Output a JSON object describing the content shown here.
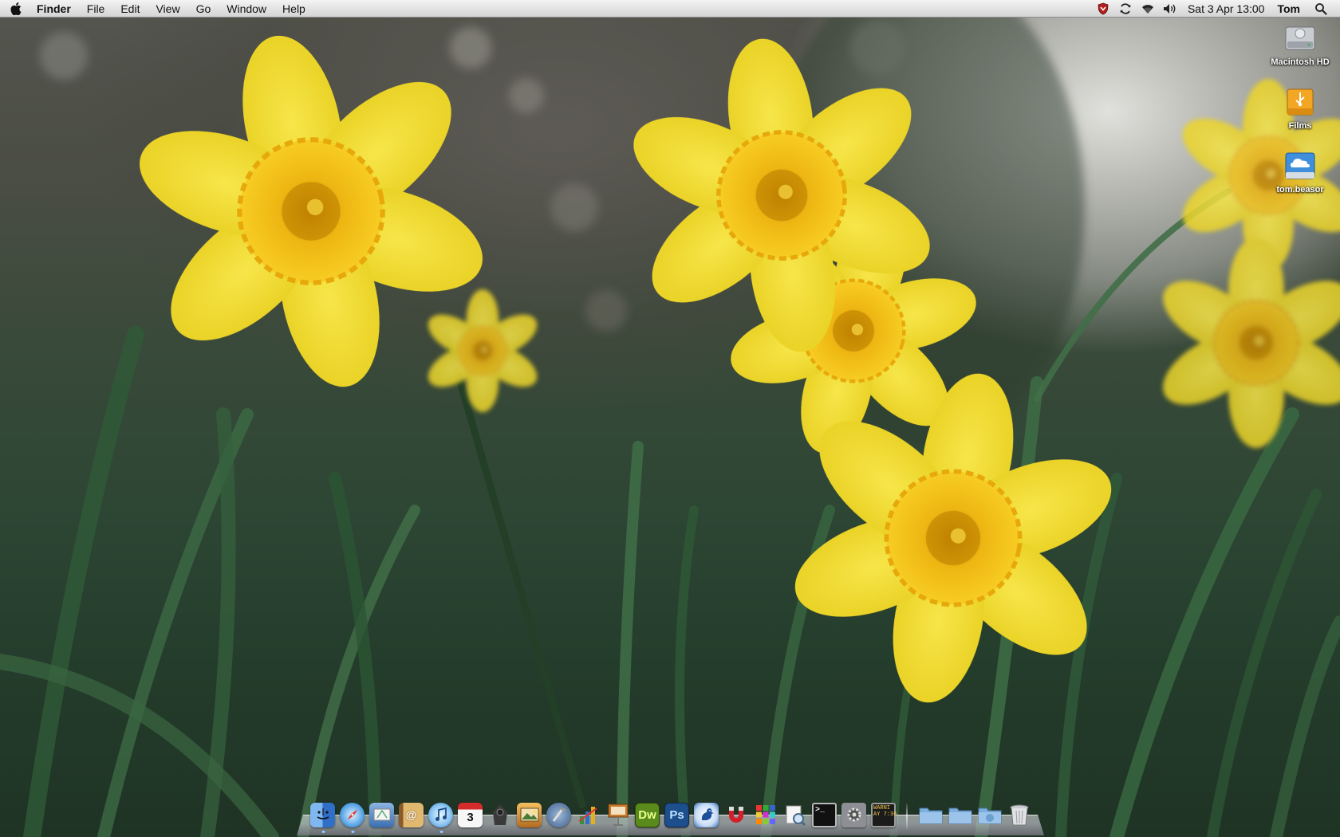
{
  "menubar": {
    "apple_icon": "apple-icon",
    "app_name": "Finder",
    "menus": [
      "File",
      "Edit",
      "View",
      "Go",
      "Window",
      "Help"
    ],
    "status_icons": [
      "shield-icon",
      "sync-icon",
      "wifi-icon",
      "volume-icon"
    ],
    "clock": "Sat 3 Apr  13:00",
    "user": "Tom",
    "search_icon": "spotlight-search-icon"
  },
  "desktop": {
    "wallpaper": "daffodils",
    "icons": [
      {
        "label": "Macintosh HD",
        "icon": "hard-drive-icon"
      },
      {
        "label": "Films",
        "icon": "usb-drive-icon"
      },
      {
        "label": "tom.beasor",
        "icon": "idisk-icon"
      }
    ]
  },
  "dock": {
    "apps": [
      {
        "name": "Finder",
        "icon": "finder-icon",
        "running": true
      },
      {
        "name": "Safari",
        "icon": "safari-icon",
        "running": true
      },
      {
        "name": "Mail",
        "icon": "mail-icon",
        "running": false
      },
      {
        "name": "Address Book",
        "icon": "address-book-icon",
        "running": false
      },
      {
        "name": "iTunes",
        "icon": "itunes-icon",
        "running": true
      },
      {
        "name": "iCal",
        "icon": "ical-icon",
        "running": false,
        "text": "3"
      },
      {
        "name": "Time Machine",
        "icon": "time-machine-icon",
        "running": false
      },
      {
        "name": "iPhoto",
        "icon": "iphoto-icon",
        "running": false
      },
      {
        "name": "Xcode",
        "icon": "xcode-icon",
        "running": false
      },
      {
        "name": "Numbers",
        "icon": "numbers-icon",
        "running": false
      },
      {
        "name": "Keynote",
        "icon": "keynote-icon",
        "running": false
      },
      {
        "name": "Dreamweaver",
        "icon": "dreamweaver-icon",
        "running": false,
        "text": "Dw"
      },
      {
        "name": "Photoshop",
        "icon": "photoshop-icon",
        "running": false,
        "text": "Ps"
      },
      {
        "name": "Cyberduck",
        "icon": "cyberduck-icon",
        "running": false
      },
      {
        "name": "Transmission",
        "icon": "magnet-icon",
        "running": false
      },
      {
        "name": "Spaces",
        "icon": "spaces-icon",
        "running": false
      },
      {
        "name": "Preview",
        "icon": "preview-icon",
        "running": false
      },
      {
        "name": "Terminal",
        "icon": "terminal-icon",
        "running": false,
        "text": ">_"
      },
      {
        "name": "System Preferences",
        "icon": "system-preferences-icon",
        "running": false
      },
      {
        "name": "Console",
        "icon": "console-icon",
        "running": false,
        "text": "WARNI\nAY 7:36"
      }
    ],
    "stacks": [
      {
        "name": "Applications",
        "icon": "folder-icon"
      },
      {
        "name": "Documents",
        "icon": "folder-icon"
      },
      {
        "name": "Downloads",
        "icon": "downloads-folder-icon"
      },
      {
        "name": "Trash",
        "icon": "trash-icon"
      }
    ]
  },
  "colors": {
    "petal": "#f2dc2e",
    "trumpet": "#f0b810",
    "dock_indicator": "#6fb4ff"
  }
}
